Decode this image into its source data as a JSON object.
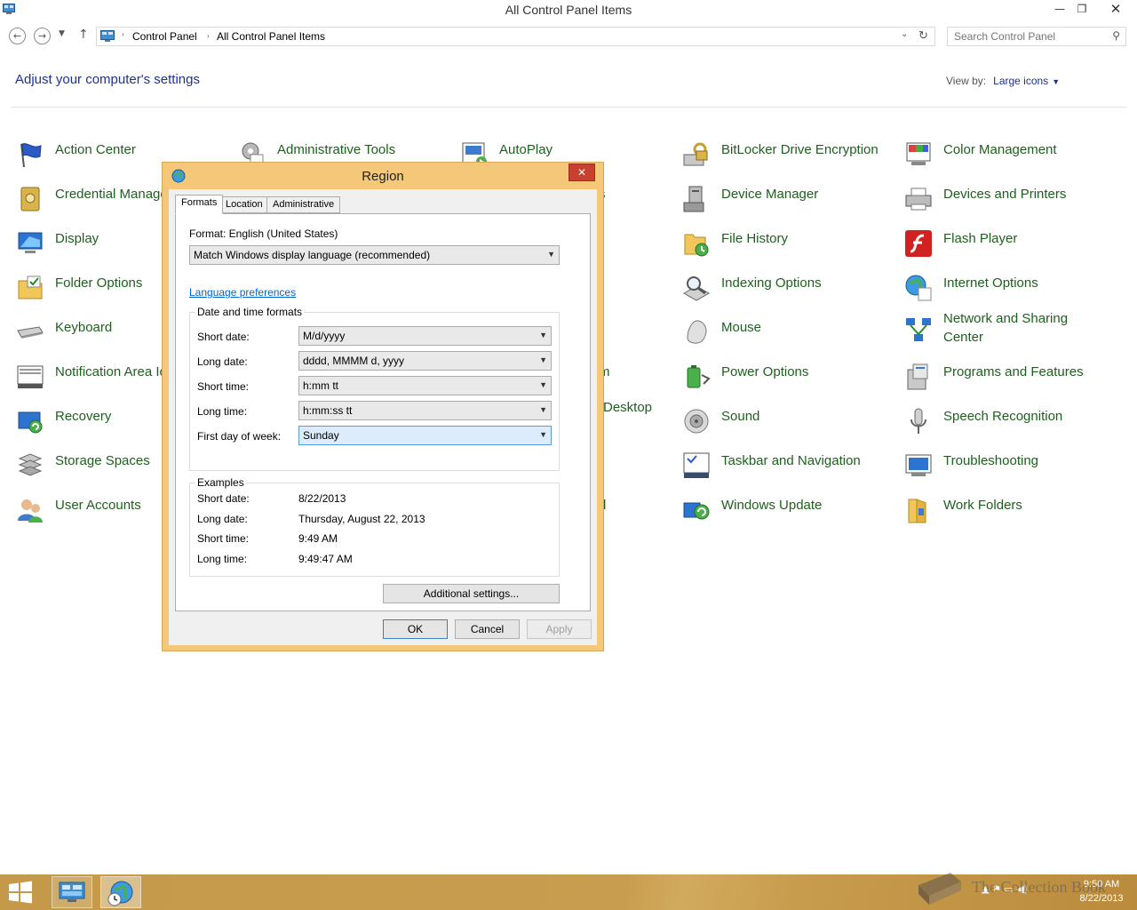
{
  "window": {
    "title": "All Control Panel Items",
    "min_glyph": "—",
    "max_glyph": "❐",
    "close_glyph": "✕"
  },
  "nav": {
    "back_glyph": "←",
    "forward_glyph": "→",
    "recent_glyph": "▼",
    "up_glyph": "↑",
    "breadcrumb": [
      "Control Panel",
      "All Control Panel Items"
    ],
    "crumb_sep": "›",
    "dropdown_glyph": "⌄",
    "refresh_glyph": "↻",
    "search_placeholder": "Search Control Panel",
    "search_glyph": "⚲"
  },
  "header": {
    "heading": "Adjust your computer's settings",
    "view_by_label": "View by:",
    "view_by_value": "Large icons",
    "view_by_caret": "▼"
  },
  "items": [
    {
      "label": "Action Center",
      "icon": "flag-icon"
    },
    {
      "label": "Administrative Tools",
      "icon": "admin-tools-icon"
    },
    {
      "label": "AutoPlay",
      "icon": "autoplay-icon"
    },
    {
      "label": "BitLocker Drive Encryption",
      "icon": "bitlocker-icon"
    },
    {
      "label": "Color Management",
      "icon": "color-management-icon"
    },
    {
      "label": "Credential Manager",
      "icon": "credential-icon"
    },
    {
      "label": "Device Manager",
      "icon": "device-manager-icon"
    },
    {
      "label": "Devices and Printers",
      "icon": "printer-icon"
    },
    {
      "label": "Display",
      "icon": "display-icon"
    },
    {
      "label": "File History",
      "icon": "file-history-icon"
    },
    {
      "label": "Flash Player",
      "icon": "flash-icon"
    },
    {
      "label": "Folder Options",
      "icon": "folder-options-icon"
    },
    {
      "label": "Indexing Options",
      "icon": "indexing-icon"
    },
    {
      "label": "Internet Options",
      "icon": "internet-options-icon"
    },
    {
      "label": "Keyboard",
      "icon": "keyboard-icon"
    },
    {
      "label": "Mouse",
      "icon": "mouse-icon"
    },
    {
      "label": "Network and Sharing Center",
      "icon": "network-icon"
    },
    {
      "label": "Notification Area Icons",
      "icon": "notification-icon"
    },
    {
      "label": "m",
      "icon": ""
    },
    {
      "label": "Power Options",
      "icon": "power-icon"
    },
    {
      "label": "Programs and Features",
      "icon": "programs-icon"
    },
    {
      "label": "Recovery",
      "icon": "recovery-icon"
    },
    {
      "label": "Desktop",
      "icon": ""
    },
    {
      "label": "Sound",
      "icon": "sound-icon"
    },
    {
      "label": "Speech Recognition",
      "icon": "microphone-icon"
    },
    {
      "label": "Storage Spaces",
      "icon": "storage-icon"
    },
    {
      "label": "Taskbar and Navigation",
      "icon": "taskbar-icon"
    },
    {
      "label": "Troubleshooting",
      "icon": "troubleshooting-icon"
    },
    {
      "label": "User Accounts",
      "icon": "users-icon"
    },
    {
      "label": "l",
      "icon": ""
    },
    {
      "label": "Windows Update",
      "icon": "windows-update-icon"
    },
    {
      "label": "Work Folders",
      "icon": "work-folders-icon"
    },
    {
      "label": "s",
      "icon": ""
    }
  ],
  "dialog": {
    "title": "Region",
    "close_glyph": "✕",
    "tabs": [
      "Formats",
      "Location",
      "Administrative"
    ],
    "format_label": "Format: English (United States)",
    "format_value": "Match Windows display language (recommended)",
    "language_link": "Language preferences",
    "date_time_group": "Date and time formats",
    "fields": [
      {
        "label": "Short date:",
        "value": "M/d/yyyy"
      },
      {
        "label": "Long date:",
        "value": "dddd, MMMM d, yyyy"
      },
      {
        "label": "Short time:",
        "value": "h:mm tt"
      },
      {
        "label": "Long time:",
        "value": "h:mm:ss tt"
      },
      {
        "label": "First day of week:",
        "value": "Sunday"
      }
    ],
    "examples_group": "Examples",
    "examples": [
      {
        "label": "Short date:",
        "value": "8/22/2013"
      },
      {
        "label": "Long date:",
        "value": "Thursday, August 22, 2013"
      },
      {
        "label": "Short time:",
        "value": "9:49 AM"
      },
      {
        "label": "Long time:",
        "value": "9:49:47 AM"
      }
    ],
    "additional_settings": "Additional settings...",
    "ok": "OK",
    "cancel": "Cancel",
    "apply": "Apply",
    "caret": "▼"
  },
  "taskbar": {
    "tray_glyphs": "▲ ⚑ ▭ ◀)",
    "time": "9:50 AM",
    "date": "8/22/2013"
  },
  "watermark": {
    "text": "The Collection Book"
  }
}
